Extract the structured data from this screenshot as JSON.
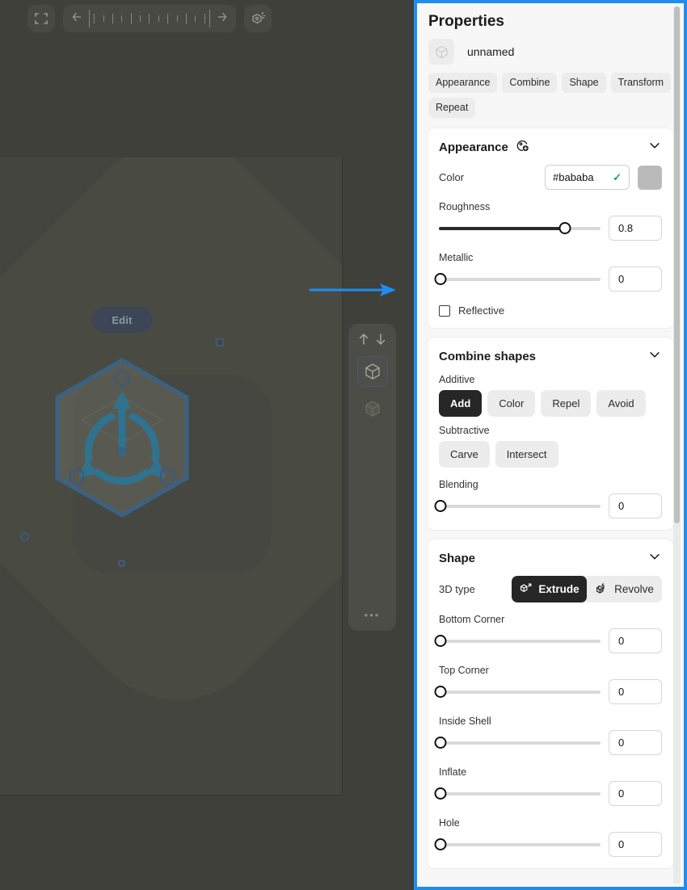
{
  "canvas": {
    "top_toolbar": {
      "frame_icon": "frame-select-icon",
      "back_icon": "arrow-left-icon",
      "forward_icon": "arrow-right-icon",
      "ruler_icon": "ruler-icon",
      "light_icon": "lighting-icon"
    },
    "edit_button_label": "Edit",
    "gizmo_icon": "rotate-gizmo-icon",
    "side_toolbar": {
      "up_icon": "arrow-up-icon",
      "down_icon": "arrow-down-icon",
      "item1_icon": "cube-outline-icon",
      "item2_icon": "cube-solid-icon",
      "more_label": "•••"
    },
    "annotation_arrow_color": "#1e8cf0"
  },
  "panel": {
    "title": "Properties",
    "object": {
      "icon": "cube-outline-icon",
      "name": "unnamed"
    },
    "tabs": [
      {
        "label": "Appearance"
      },
      {
        "label": "Combine"
      },
      {
        "label": "Shape"
      },
      {
        "label": "Transform"
      },
      {
        "label": "Repeat"
      }
    ],
    "appearance": {
      "title": "Appearance",
      "add_material_icon": "add-material-icon",
      "collapse_icon": "chevron-down-icon",
      "color": {
        "label": "Color",
        "value": "#bababa",
        "valid_icon": "check-icon",
        "swatch_color": "#bababa"
      },
      "sliders": [
        {
          "label": "Roughness",
          "value": "0.8",
          "percent": 78
        },
        {
          "label": "Metallic",
          "value": "0",
          "percent": 0
        }
      ],
      "reflective": {
        "label": "Reflective",
        "checked": false
      }
    },
    "combine": {
      "title": "Combine shapes",
      "collapse_icon": "chevron-down-icon",
      "additive_label": "Additive",
      "additive_options": [
        {
          "label": "Add",
          "selected": true
        },
        {
          "label": "Color",
          "selected": false
        },
        {
          "label": "Repel",
          "selected": false
        },
        {
          "label": "Avoid",
          "selected": false
        }
      ],
      "subtractive_label": "Subtractive",
      "subtractive_options": [
        {
          "label": "Carve",
          "selected": false
        },
        {
          "label": "Intersect",
          "selected": false
        }
      ],
      "blending": {
        "label": "Blending",
        "value": "0",
        "percent": 0
      }
    },
    "shape": {
      "title": "Shape",
      "collapse_icon": "chevron-down-icon",
      "type_label": "3D type",
      "type_options": [
        {
          "label": "Extrude",
          "icon": "extrude-icon",
          "selected": true
        },
        {
          "label": "Revolve",
          "icon": "revolve-icon",
          "selected": false
        }
      ],
      "sliders": [
        {
          "label": "Bottom Corner",
          "value": "0",
          "percent": 0
        },
        {
          "label": "Top Corner",
          "value": "0",
          "percent": 0
        },
        {
          "label": "Inside Shell",
          "value": "0",
          "percent": 0
        },
        {
          "label": "Inflate",
          "value": "0",
          "percent": 0
        },
        {
          "label": "Hole",
          "value": "0",
          "percent": 0
        }
      ]
    }
  }
}
